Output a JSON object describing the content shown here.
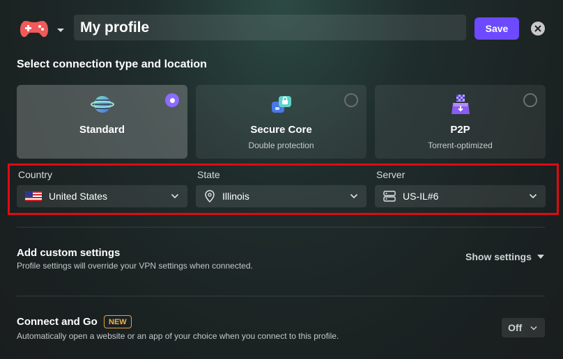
{
  "header": {
    "profile_name": "My profile",
    "save_label": "Save"
  },
  "connection": {
    "section_title": "Select connection type and location",
    "options": [
      {
        "title": "Standard",
        "subtitle": "",
        "selected": true,
        "icon": "globe-icon"
      },
      {
        "title": "Secure Core",
        "subtitle": "Double protection",
        "selected": false,
        "icon": "secure-core-icon"
      },
      {
        "title": "P2P",
        "subtitle": "Torrent-optimized",
        "selected": false,
        "icon": "p2p-icon"
      }
    ]
  },
  "location": {
    "country_label": "Country",
    "country_value": "United States",
    "state_label": "State",
    "state_value": "Illinois",
    "server_label": "Server",
    "server_value": "US-IL#6"
  },
  "custom_settings": {
    "title": "Add custom settings",
    "description": "Profile settings will override your VPN settings when connected.",
    "toggle_label": "Show settings"
  },
  "connect_and_go": {
    "title": "Connect and Go",
    "badge": "NEW",
    "description": "Automatically open a website or an app of your choice when you connect to this profile.",
    "value": "Off"
  },
  "colors": {
    "accent": "#6d4aff",
    "radio_selected": "#8b6cff",
    "highlight": "#e00a14",
    "badge": "#e8a23a"
  }
}
